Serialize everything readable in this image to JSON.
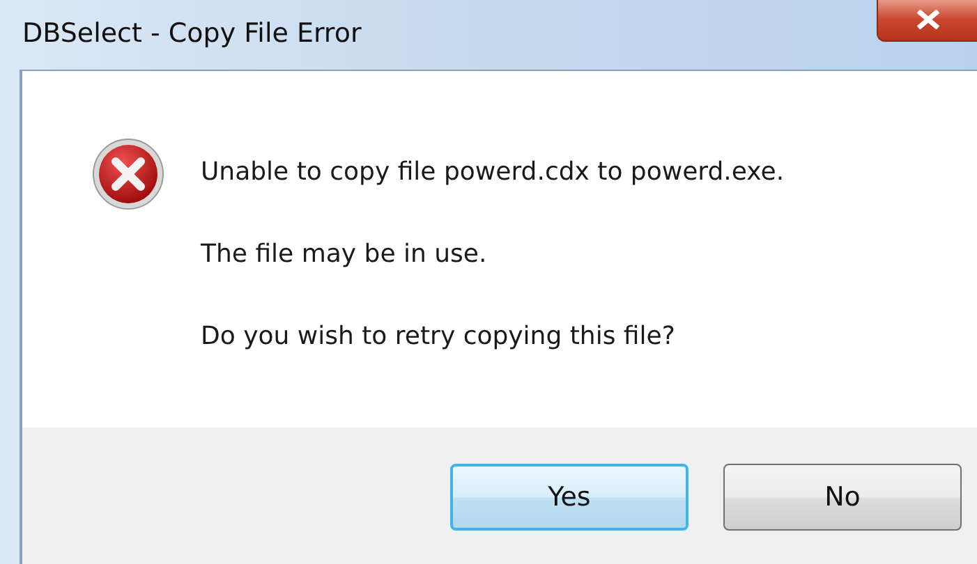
{
  "window": {
    "title": "DBSelect - Copy File Error"
  },
  "message": {
    "kind": "error",
    "lines": [
      "Unable to copy file powerd.cdx to powerd.exe.",
      "The file may be in use.",
      "Do you wish to retry copying this file?"
    ]
  },
  "buttons": [
    {
      "label": "Yes",
      "default": true
    },
    {
      "label": "No",
      "default": false
    }
  ]
}
